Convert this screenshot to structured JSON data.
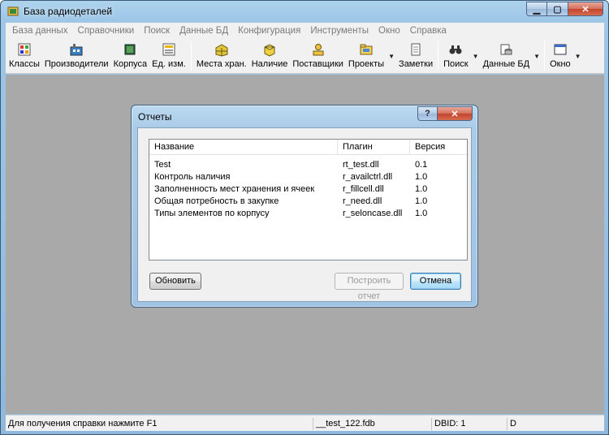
{
  "window": {
    "title": "База радиодеталей"
  },
  "menubar": [
    "База данных",
    "Справочники",
    "Поиск",
    "Данные БД",
    "Конфигурация",
    "Инструменты",
    "Окно",
    "Справка"
  ],
  "toolbar": {
    "classes": "Классы",
    "manufacturers": "Производители",
    "packages": "Корпуса",
    "units": "Ед. изм.",
    "storage": "Места хран.",
    "stock": "Наличие",
    "suppliers": "Поставщики",
    "projects": "Проекты",
    "notes": "Заметки",
    "search": "Поиск",
    "db_data": "Данные БД",
    "window": "Окно"
  },
  "dialog": {
    "title": "Отчеты",
    "help_glyph": "?",
    "close_glyph": "✕",
    "columns": [
      "Название",
      "Плагин",
      "Версия"
    ],
    "rows": [
      {
        "name": "Test",
        "plugin": "rt_test.dll",
        "version": "0.1"
      },
      {
        "name": "Контроль наличия",
        "plugin": "r_availctrl.dll",
        "version": "1.0"
      },
      {
        "name": "Заполненность мест хранения и ячеек",
        "plugin": "r_fillcell.dll",
        "version": "1.0"
      },
      {
        "name": "Общая потребность в закупке",
        "plugin": "r_need.dll",
        "version": "1.0"
      },
      {
        "name": "Типы элементов по корпусу",
        "plugin": "r_seloncase.dll",
        "version": "1.0"
      }
    ],
    "refresh_label": "Обновить",
    "build_label": "Построить отчет",
    "cancel_label": "Отмена"
  },
  "statusbar": {
    "help": "Для получения справки нажмите F1",
    "file": "__test_122.fdb",
    "dbid": "DBID: 1",
    "flag": "D"
  },
  "colors": {
    "accent": "#3c7fb1",
    "client_bg": "#a9a9a9",
    "close_red": "#c3442c"
  }
}
